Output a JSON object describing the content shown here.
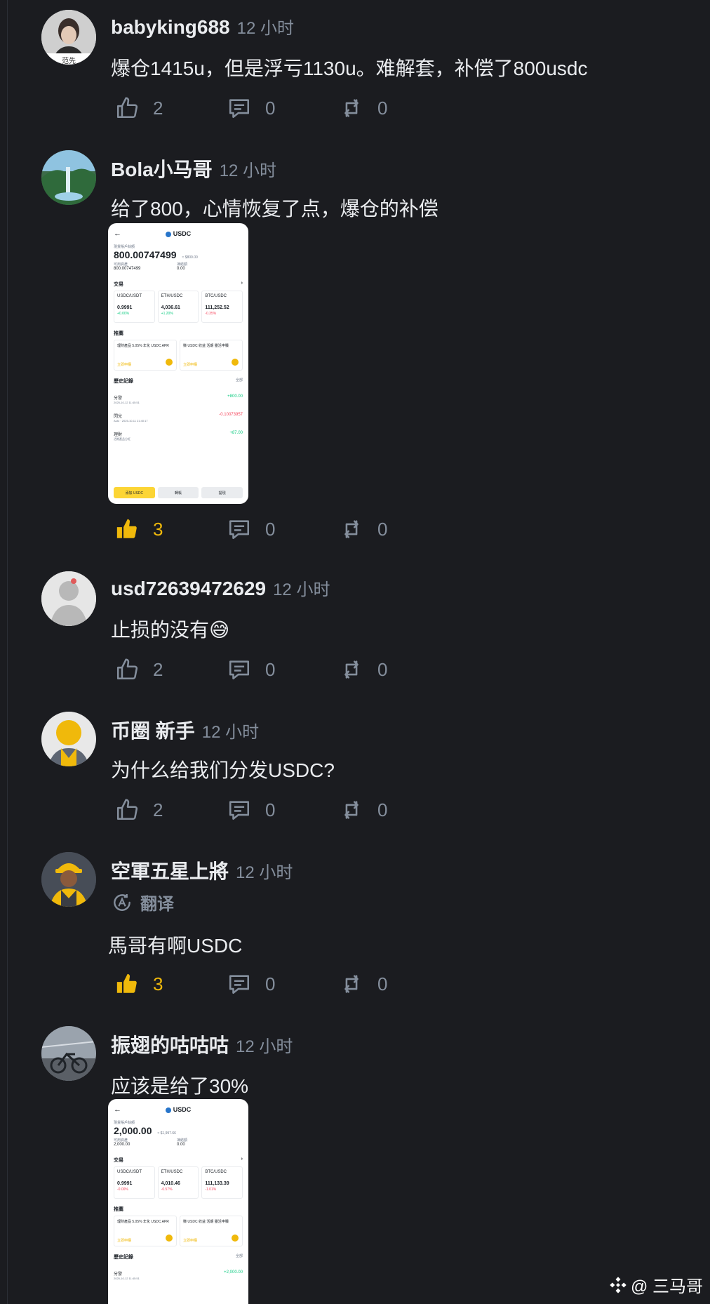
{
  "comments": [
    {
      "username": "babyking688",
      "time": "12 小时",
      "text": "爆仓1415u，但是浮亏1130u。难解套，补偿了800usdc",
      "likes": "2",
      "replies": "0",
      "reposts": "0",
      "liked": false,
      "avatar_caption": "范先"
    },
    {
      "username": "Bola小马哥",
      "time": "12 小时",
      "text": "给了800，心情恢复了点，爆仓的补偿",
      "likes": "3",
      "replies": "0",
      "reposts": "0",
      "liked": true
    },
    {
      "username": "usd72639472629",
      "time": "12 小时",
      "text": "止损的没有😅",
      "likes": "2",
      "replies": "0",
      "reposts": "0",
      "liked": false
    },
    {
      "username": "币圈 新手",
      "time": "12 小时",
      "text": "为什么给我们分发USDC?",
      "likes": "2",
      "replies": "0",
      "reposts": "0",
      "liked": false
    },
    {
      "username": "空軍五星上將",
      "time": "12 小时",
      "translate_label": "翻译",
      "text": "馬哥有啊USDC",
      "likes": "3",
      "replies": "0",
      "reposts": "0",
      "liked": true
    },
    {
      "username": "振翅的咕咕咕",
      "time": "12 小时",
      "text": "应该是给了30%"
    }
  ],
  "thumbnails": [
    {
      "title": "USDC",
      "balance_label": "現貨賬戶餘額",
      "balance": "800.00747499",
      "usd_equiv": "≈ $800.00",
      "avail_label": "可用資產",
      "avail": "800.00747499",
      "frozen_label": "凍結額",
      "frozen": "0.00",
      "trade_label": "交易",
      "pairs": [
        {
          "name": "USDC/USDT",
          "price": "0.9991",
          "change": "+0.00%",
          "dir": "pos"
        },
        {
          "name": "ETH/USDC",
          "price": "4,036.61",
          "change": "+1.20%",
          "dir": "pos"
        },
        {
          "name": "BTC/USDC",
          "price": "111,252.52",
          "change": "-0.35%",
          "dir": "neg"
        }
      ],
      "recommend_label": "推薦",
      "recs": [
        {
          "text": "理財產品 5.05% 年化 USDC APR",
          "link": "立即申購"
        },
        {
          "text": "賺 USDC 收益 活期 靈活申贖",
          "link": "立即申購"
        }
      ],
      "history_label": "歷史記錄",
      "history_filter": "全部",
      "history": [
        {
          "name": "分發",
          "sub": "2025-10-12 11:45:51",
          "amount": "+800.00",
          "dir": "pos"
        },
        {
          "name": "閃兌",
          "sub": "Auto · 2025-10-11 21:40:17",
          "amount": "-0.10073957",
          "dir": "neg"
        },
        {
          "name": "理財",
          "sub": "活期產品分紅",
          "amount": "+87.00",
          "dir": "pos"
        }
      ],
      "buttons": [
        "添加 USDC",
        "轉帳",
        "提現"
      ]
    },
    {
      "title": "USDC",
      "balance_label": "現貨賬戶餘額",
      "balance": "2,000.00",
      "usd_equiv": "≈ $1,997.66",
      "avail_label": "可用資產",
      "avail": "2,000.00",
      "frozen_label": "凍結額",
      "frozen": "0.00",
      "trade_label": "交易",
      "pairs": [
        {
          "name": "USDC/USDT",
          "price": "0.9991",
          "change": "-0.00%",
          "dir": "neg"
        },
        {
          "name": "ETH/USDC",
          "price": "4,010.46",
          "change": "-0.57%",
          "dir": "neg"
        },
        {
          "name": "BTC/USDC",
          "price": "111,133.39",
          "change": "-1.01%",
          "dir": "neg"
        }
      ],
      "recommend_label": "推薦",
      "recs": [
        {
          "text": "理財產品 5.05% 年化 USDC APR",
          "link": "立即申購"
        },
        {
          "text": "賺 USDC 收益 活期 靈活申贖",
          "link": "立即申購"
        }
      ],
      "history_label": "歷史記錄",
      "history_filter": "全部",
      "history": [
        {
          "name": "分發",
          "sub": "2025-10-12 11:45:51",
          "amount": "+2,000.00",
          "dir": "pos"
        }
      ],
      "buttons": []
    }
  ],
  "watermark": "@ 三马哥"
}
